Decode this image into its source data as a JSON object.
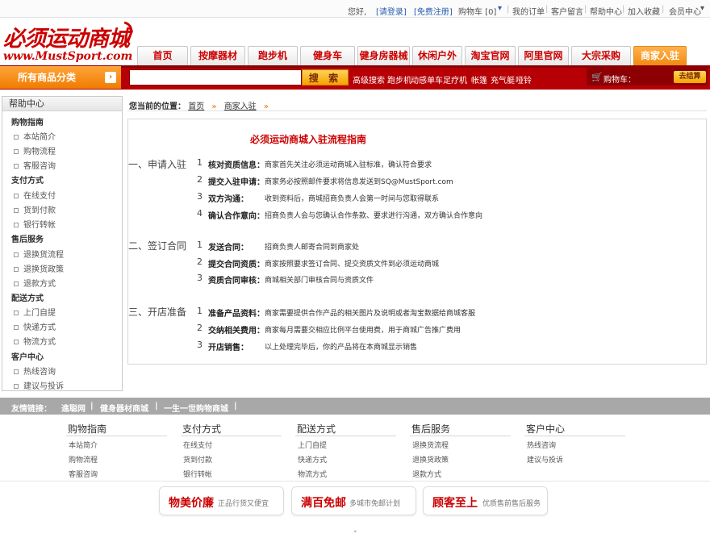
{
  "topbar": {
    "greeting": "您好,",
    "login": "[请登录]",
    "register": "[免费注册]",
    "cart": "购物车 [0]",
    "my_orders": "我的订单",
    "guestbook": "客户留言",
    "help": "帮助中心",
    "favorite": "加入收藏",
    "member": "会员中心"
  },
  "logo": {
    "cn": "必须运动商城",
    "en": "www.MustSport.com"
  },
  "nav": {
    "tabs": [
      "首页",
      "按摩器材",
      "跑步机",
      "健身车",
      "健身房器械",
      "休闲户外",
      "淘宝官网",
      "阿里官网",
      "大宗采购",
      "商家入驻"
    ],
    "active": "商家入驻"
  },
  "search": {
    "all_categories": "所有商品分类",
    "placeholder": "",
    "button": "搜 索",
    "hot": [
      "高级搜索",
      "跑步机",
      "动感单车",
      "足疗机",
      "帐篷",
      "充气艇",
      "哑铃"
    ],
    "cart_label": "购物车：",
    "checkout": "去结算"
  },
  "sidebar": {
    "title": "帮助中心",
    "groups": [
      {
        "name": "购物指南",
        "items": [
          "本站简介",
          "购物流程",
          "客服咨询"
        ]
      },
      {
        "name": "支付方式",
        "items": [
          "在线支付",
          "货到付款",
          "银行转帐"
        ]
      },
      {
        "name": "售后服务",
        "items": [
          "退换货流程",
          "退换货政策",
          "退款方式"
        ]
      },
      {
        "name": "配送方式",
        "items": [
          "上门自提",
          "快递方式",
          "物流方式"
        ]
      },
      {
        "name": "客户中心",
        "items": [
          "热线咨询",
          "建议与投诉"
        ]
      }
    ]
  },
  "breadcrumb": {
    "label": "您当前的位置：",
    "home": "首页",
    "current": "商家入驻",
    "arrow": "»"
  },
  "content": {
    "title": "必须运动商城入驻流程指南",
    "sections": [
      {
        "title": "一、申请入驻",
        "steps": [
          {
            "num": "1",
            "label": "核对资质信息：",
            "text": "商家首先关注必须运动商城入驻标准，确认符合要求"
          },
          {
            "num": "2",
            "label": "提交入驻申请：",
            "text": "商家务必按照邮件要求将信息发送到SQ@MustSport.com"
          },
          {
            "num": "3",
            "label": "双方沟通：",
            "text": "收到资料后，商城招商负责人会第一时间与您取得联系"
          },
          {
            "num": "4",
            "label": "确认合作意向：",
            "text": "招商负责人会与您确认合作条款、要求进行沟通，双方确认合作意向"
          }
        ]
      },
      {
        "title": "二、签订合同",
        "steps": [
          {
            "num": "1",
            "label": "发送合同：",
            "text": "招商负责人邮寄合同到商家处"
          },
          {
            "num": "2",
            "label": "提交合同资质：",
            "text": "商家按照要求签订合同、提交资质文件到必须运动商城"
          },
          {
            "num": "3",
            "label": "资质合同审核：",
            "text": "商城相关部门审核合同与资质文件"
          }
        ]
      },
      {
        "title": "三、开店准备",
        "steps": [
          {
            "num": "1",
            "label": "准备产品资料：",
            "text": "商家需要提供合作产品的相关图片及说明或者淘宝数据给商城客服"
          },
          {
            "num": "2",
            "label": "交纳相关费用：",
            "text": "商家每月需要交相应比例平台使用费，用于商城广告推广费用"
          },
          {
            "num": "3",
            "label": "开店销售：",
            "text": "以上处理完毕后，你的产品将在本商城显示销售"
          }
        ]
      }
    ]
  },
  "footer": {
    "links_label": "友情链接：",
    "links": [
      "進聪网",
      "健身器材商城",
      "一生一世购物商城"
    ],
    "columns": [
      {
        "title": "购物指南",
        "items": [
          "本站简介",
          "购物流程",
          "客服咨询"
        ]
      },
      {
        "title": "支付方式",
        "items": [
          "在线支付",
          "货到付款",
          "银行转帐"
        ]
      },
      {
        "title": "配送方式",
        "items": [
          "上门自提",
          "快递方式",
          "物流方式"
        ]
      },
      {
        "title": "售后服务",
        "items": [
          "退换货流程",
          "退换货政策",
          "退款方式"
        ]
      },
      {
        "title": "客户中心",
        "items": [
          "热线咨询",
          "建议与投诉"
        ]
      }
    ],
    "badges": [
      {
        "main": "物美价廉",
        "sub": "正品行货又便宜"
      },
      {
        "main": "满百免邮",
        "sub": "多城市免邮计划"
      },
      {
        "main": "顾客至上",
        "sub": "优质售前售后服务"
      }
    ]
  },
  "colors": {
    "brand_red": "#b60005",
    "accent_orange": "#f08a10",
    "link_blue": "#2a5db0"
  }
}
